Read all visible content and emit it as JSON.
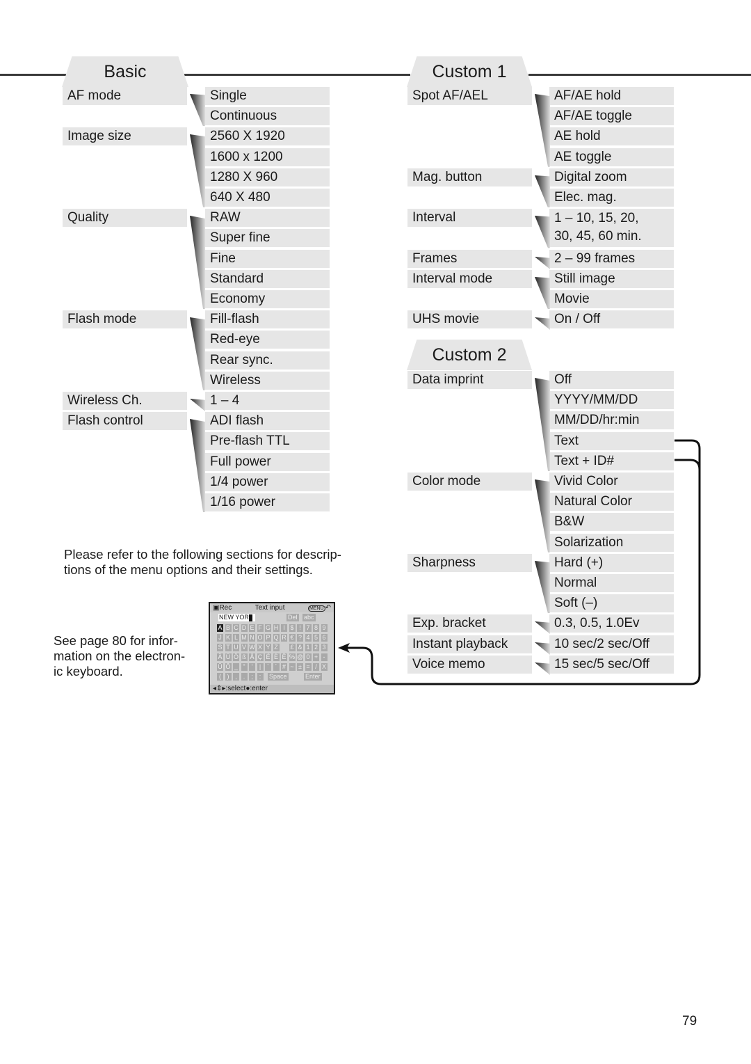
{
  "basic": {
    "title": "Basic",
    "groups": [
      {
        "label": "AF mode",
        "options": [
          "Single",
          "Continuous"
        ]
      },
      {
        "label": "Image size",
        "options": [
          "2560 X 1920",
          "1600 x 1200",
          "1280 X 960",
          "640 X 480"
        ]
      },
      {
        "label": "Quality",
        "options": [
          "RAW",
          "Super fine",
          "Fine",
          "Standard",
          "Economy"
        ]
      },
      {
        "label": "Flash mode",
        "options": [
          "Fill-flash",
          "Red-eye",
          "Rear sync.",
          "Wireless"
        ]
      },
      {
        "label": "Wireless Ch.",
        "options": [
          "1 – 4"
        ]
      },
      {
        "label": "Flash control",
        "options": [
          "ADI flash",
          "Pre-flash TTL",
          "Full power",
          "1/4 power",
          "1/16 power"
        ]
      }
    ]
  },
  "custom1": {
    "title": "Custom 1",
    "groups": [
      {
        "label": "Spot AF/AEL",
        "options": [
          "AF/AE hold",
          "AF/AE toggle",
          "AE hold",
          "AE toggle"
        ]
      },
      {
        "label": "Mag. button",
        "options": [
          "Digital zoom",
          "Elec. mag."
        ]
      },
      {
        "label": "Interval",
        "options": [
          "1 – 10, 15, 20, 30, 45, 60 min."
        ]
      },
      {
        "label": "Frames",
        "options": [
          "2 – 99 frames"
        ]
      },
      {
        "label": "Interval mode",
        "options": [
          "Still image",
          "Movie"
        ]
      },
      {
        "label": "UHS movie",
        "options": [
          "On / Off"
        ]
      }
    ]
  },
  "custom2": {
    "title": "Custom 2",
    "groups": [
      {
        "label": "Data imprint",
        "options": [
          "Off",
          "YYYY/MM/DD",
          "MM/DD/hr:min",
          "Text",
          "Text + ID#"
        ]
      },
      {
        "label": "Color mode",
        "options": [
          "Vivid Color",
          "Natural Color",
          "B&W",
          "Solarization"
        ]
      },
      {
        "label": "Sharpness",
        "options": [
          "Hard (+)",
          "Normal",
          "Soft (–)"
        ]
      },
      {
        "label": "Exp. bracket",
        "options": [
          "0.3, 0.5, 1.0Ev"
        ]
      },
      {
        "label": "Instant playback",
        "options": [
          "10 sec/2 sec/Off"
        ]
      },
      {
        "label": "Voice memo",
        "options": [
          "15 sec/5 sec/Off"
        ]
      }
    ]
  },
  "notes": {
    "refer": "Please refer to the following sections for descrip- tions of the menu options and their settings.",
    "refer_line1": "Please refer to the following sections for descrip-",
    "refer_line2": "tions of the menu options and their settings.",
    "keyboard_line1": "See page 80 for infor-",
    "keyboard_line2": "mation on the electron-",
    "keyboard_line3": "ic keyboard."
  },
  "keyboard_screen": {
    "mode": "Rec",
    "title": "Text input",
    "menu_label": "MENU",
    "input_value": "NEW YOR",
    "del_label": "Del",
    "case_label": "abc",
    "rows": [
      [
        "A",
        "B",
        "C",
        "D",
        "E",
        "F",
        "G",
        "H",
        "I",
        "$",
        "!",
        "7",
        "8",
        "9"
      ],
      [
        "J",
        "K",
        "L",
        "M",
        "N",
        "O",
        "P",
        "Q",
        "R",
        "€",
        "?",
        "4",
        "5",
        "6"
      ],
      [
        "S",
        "T",
        "U",
        "V",
        "W",
        "X",
        "Y",
        "Z",
        "",
        "£",
        "&",
        "1",
        "2",
        "3"
      ],
      [
        "Ä",
        "Ü",
        "Ö",
        "ß",
        "Å",
        "Ç",
        "É",
        "È",
        "Ë",
        "%",
        "@",
        "0",
        "+",
        "-"
      ],
      [
        "Û",
        "Ô",
        "_",
        "\"",
        "'",
        "|",
        "`",
        "´",
        "#",
        "~",
        "±",
        "=",
        "/",
        "X"
      ],
      [
        "(",
        ")",
        ",",
        ".",
        ";",
        ":"
      ]
    ],
    "space_label": "Space",
    "enter_label": "Enter",
    "footer": ":select●:enter"
  },
  "page_number": "79"
}
